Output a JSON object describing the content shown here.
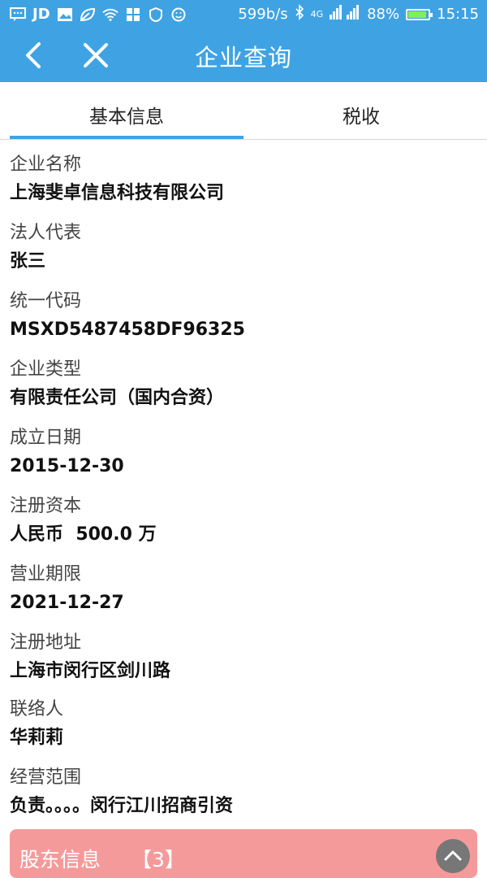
{
  "status_bar": {
    "left_icons": [
      "message-icon",
      "jd-icon",
      "image-icon",
      "leaf-icon",
      "wifi-icon",
      "apps-icon",
      "shield-icon",
      "smile-icon"
    ],
    "left_jd_text": "JD",
    "speed": "599b/s",
    "network": "4G",
    "battery_percent": "88%",
    "time": "15:15"
  },
  "app_bar": {
    "title": "企业查询",
    "bg_color": "#3fa3e3"
  },
  "tabs": [
    {
      "label": "基本信息",
      "active": true
    },
    {
      "label": "税收",
      "active": false
    }
  ],
  "fields": [
    {
      "label": "企业名称",
      "value": "上海斐卓信息科技有限公司"
    },
    {
      "label": "法人代表",
      "value": "张三"
    },
    {
      "label": "统一代码",
      "value": "MSXD5487458DF96325"
    },
    {
      "label": "企业类型",
      "value": "有限责任公司（国内合资）"
    },
    {
      "label": "成立日期",
      "value": "2015-12-30"
    },
    {
      "label": "注册资本",
      "value": "人民币  500.0 万"
    },
    {
      "label": "营业期限",
      "value": "2021-12-27"
    },
    {
      "label": "注册地址",
      "value": "上海市闵行区剑川路"
    },
    {
      "label": "联络人",
      "value": "华莉莉"
    },
    {
      "label": "经营范围",
      "value": "负责。。。。闵行江川招商引资"
    }
  ],
  "shareholder": {
    "label": "股东信息",
    "count": "【3】",
    "bg_color": "#f59a9b"
  }
}
